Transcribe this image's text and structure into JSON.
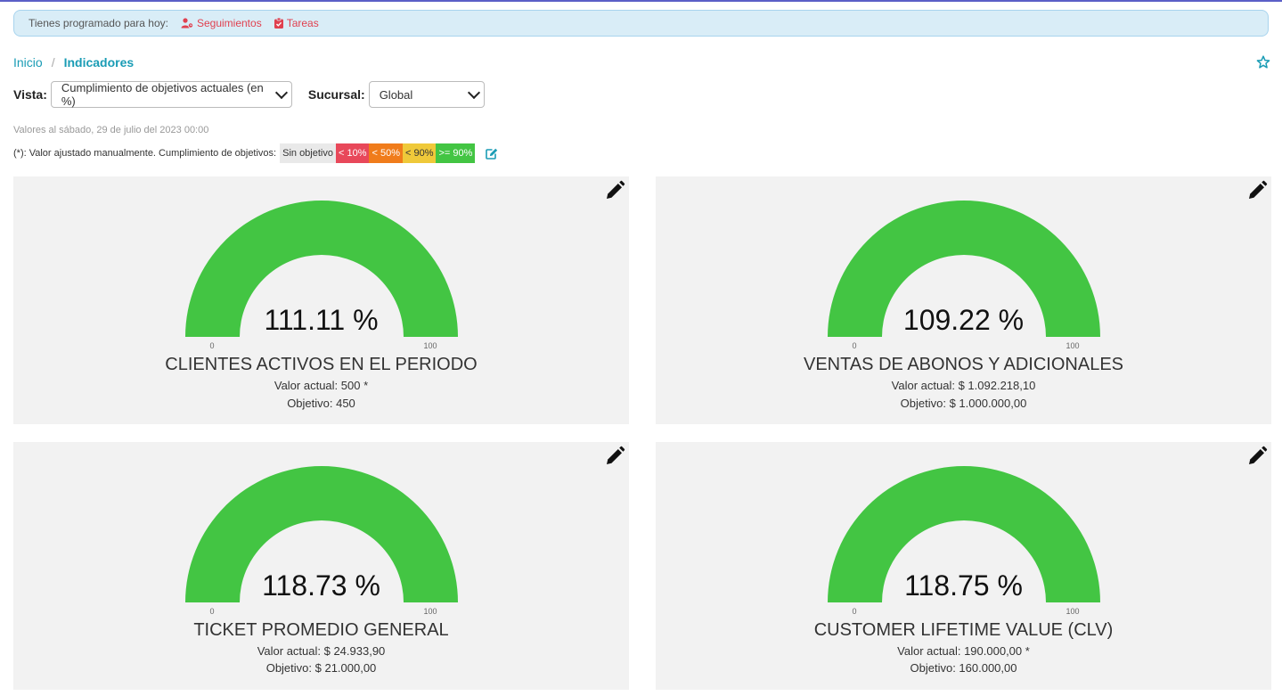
{
  "alert": {
    "text": "Tienes programado para hoy:",
    "followups_label": "Seguimientos",
    "tasks_label": "Tareas"
  },
  "breadcrumb": {
    "home": "Inicio",
    "separator": "/",
    "current": "Indicadores"
  },
  "filters": {
    "view_label": "Vista:",
    "view_value": "Cumplimiento de objetivos actuales (en %)",
    "branch_label": "Sucursal:",
    "branch_value": "Global"
  },
  "as_of": "Valores al sábado, 29 de julio del 2023 00:00",
  "legend": {
    "text": "(*): Valor ajustado manualmente. Cumplimiento de objetivos:",
    "items": [
      {
        "label": "Sin objetivo",
        "bg": "#e9e9e9",
        "fg": "#333333"
      },
      {
        "label": "< 10%",
        "bg": "#e8485a",
        "fg": "#ffffff"
      },
      {
        "label": "< 50%",
        "bg": "#f07c1b",
        "fg": "#ffffff"
      },
      {
        "label": "< 90%",
        "bg": "#efc93a",
        "fg": "#333333"
      },
      {
        "label": ">= 90%",
        "bg": "#43c543",
        "fg": "#ffffff"
      }
    ]
  },
  "colors": {
    "gauge_fill": "#43c543",
    "accent": "#1a9cb5",
    "alert_link": "#e0404f"
  },
  "gauge_scale": {
    "min": "0",
    "max": "100"
  },
  "cards": [
    {
      "pct": "111.11 %",
      "title": "CLIENTES ACTIVOS EN EL PERIODO",
      "current": "Valor actual: 500 *",
      "target": "Objetivo: 450"
    },
    {
      "pct": "109.22 %",
      "title": "VENTAS DE ABONOS Y ADICIONALES",
      "current": "Valor actual: $ 1.092.218,10",
      "target": "Objetivo: $ 1.000.000,00"
    },
    {
      "pct": "118.73 %",
      "title": "TICKET PROMEDIO GENERAL",
      "current": "Valor actual: $ 24.933,90",
      "target": "Objetivo: $ 21.000,00"
    },
    {
      "pct": "118.75 %",
      "title": "CUSTOMER LIFETIME VALUE (CLV)",
      "current": "Valor actual: 190.000,00 *",
      "target": "Objetivo: 160.000,00"
    }
  ]
}
